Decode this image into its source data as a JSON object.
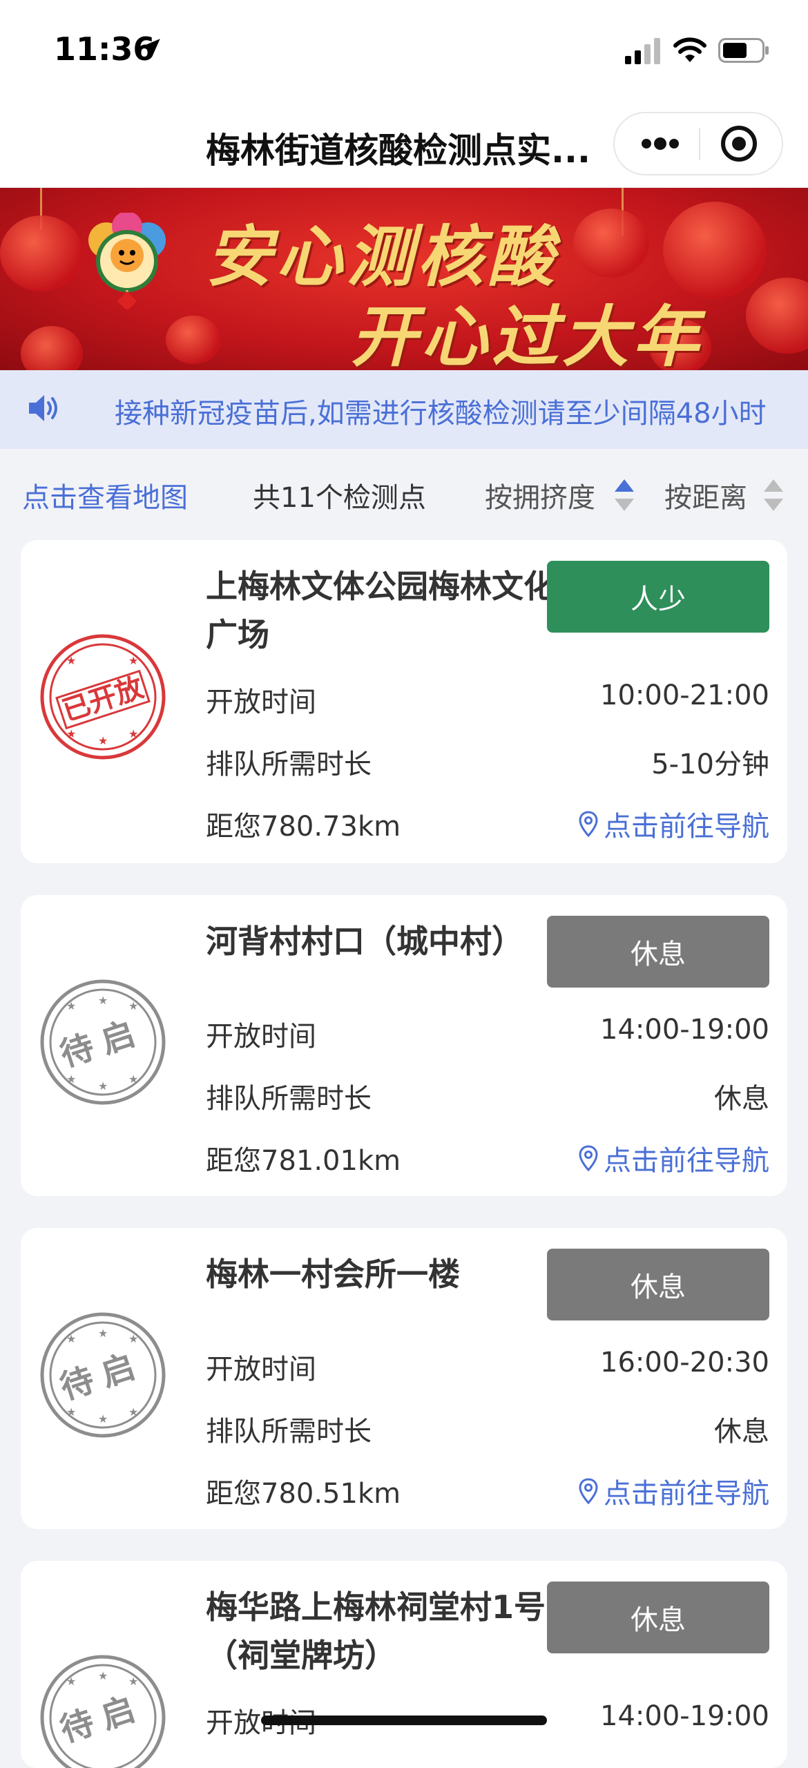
{
  "status_bar": {
    "time": "11:36"
  },
  "nav": {
    "title": "梅林街道核酸检测点实..."
  },
  "banner": {
    "slogan_line1": "安心测核酸",
    "slogan_line2": "开心过大年"
  },
  "notice": {
    "text": "接种新冠疫苗后,如需进行核酸检测请至少间隔48小时"
  },
  "filter": {
    "map_link": "点击查看地图",
    "count": "共11个检测点",
    "sort_crowd": "按拥挤度",
    "sort_distance": "按距离"
  },
  "labels": {
    "open_time": "开放时间",
    "queue_time": "排队所需时长",
    "navigate": "点击前往导航"
  },
  "stamp_text": {
    "open": "已开放",
    "pending": "待启"
  },
  "colors": {
    "green": "#2f8f5b",
    "gray": "#7a7a7a",
    "blue": "#4a6fd6",
    "stamp_red": "#d9383a",
    "stamp_gray": "#8d8d8d"
  },
  "sites": [
    {
      "name": "上梅林文体公园梅林文化广场",
      "status": "人少",
      "status_color": "green",
      "stamp": "已开放",
      "open_time": "10:00-21:00",
      "queue": "5-10分钟",
      "distance": "距您780.73km"
    },
    {
      "name": "河背村村口（城中村）",
      "status": "休息",
      "status_color": "gray",
      "stamp": "待启",
      "open_time": "14:00-19:00",
      "queue": "休息",
      "distance": "距您781.01km"
    },
    {
      "name": "梅林一村会所一楼",
      "status": "休息",
      "status_color": "gray",
      "stamp": "待启",
      "open_time": "16:00-20:30",
      "queue": "休息",
      "distance": "距您780.51km"
    },
    {
      "name": "梅华路上梅林祠堂村1号（祠堂牌坊）",
      "status": "休息",
      "status_color": "gray",
      "stamp": "待启",
      "open_time": "14:00-19:00"
    }
  ]
}
